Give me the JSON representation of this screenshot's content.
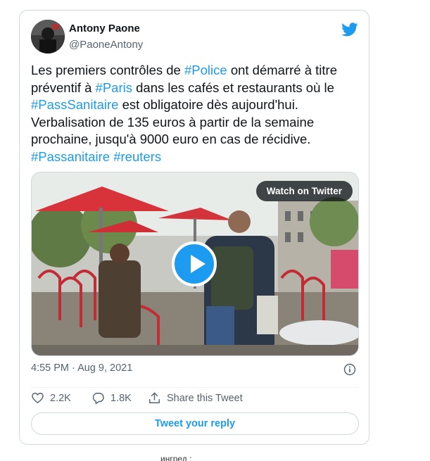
{
  "tweet": {
    "author_name": "Antony Paone",
    "author_handle": "@PaoneAntony",
    "text_segments": [
      "Les premiers contrôles de ",
      "#Police",
      " ont démarré à titre préventif à ",
      "#Paris",
      " dans les cafés et restaurants où le  ",
      "#PassSanitaire",
      " est obligatoire dès aujourd'hui. Verbalisation de 135 euros à partir de la semaine prochaine, jusqu'à 9000 euro en cas de récidive. ",
      "#Passanitaire",
      " ",
      "#reuters"
    ],
    "timestamp": "4:55 PM · Aug 9, 2021"
  },
  "media": {
    "watch_label": "Watch on Twitter",
    "play_icon": "play-icon"
  },
  "actions": {
    "likes": "2.2K",
    "replies": "1.8K",
    "share_label": "Share this Tweet",
    "reply_button_label": "Tweet your reply"
  },
  "page": {
    "truncated_text": "ингред :"
  },
  "colors": {
    "accent": "#1d9bf0",
    "secondary_text": "#536471",
    "border": "#cfd9de"
  }
}
